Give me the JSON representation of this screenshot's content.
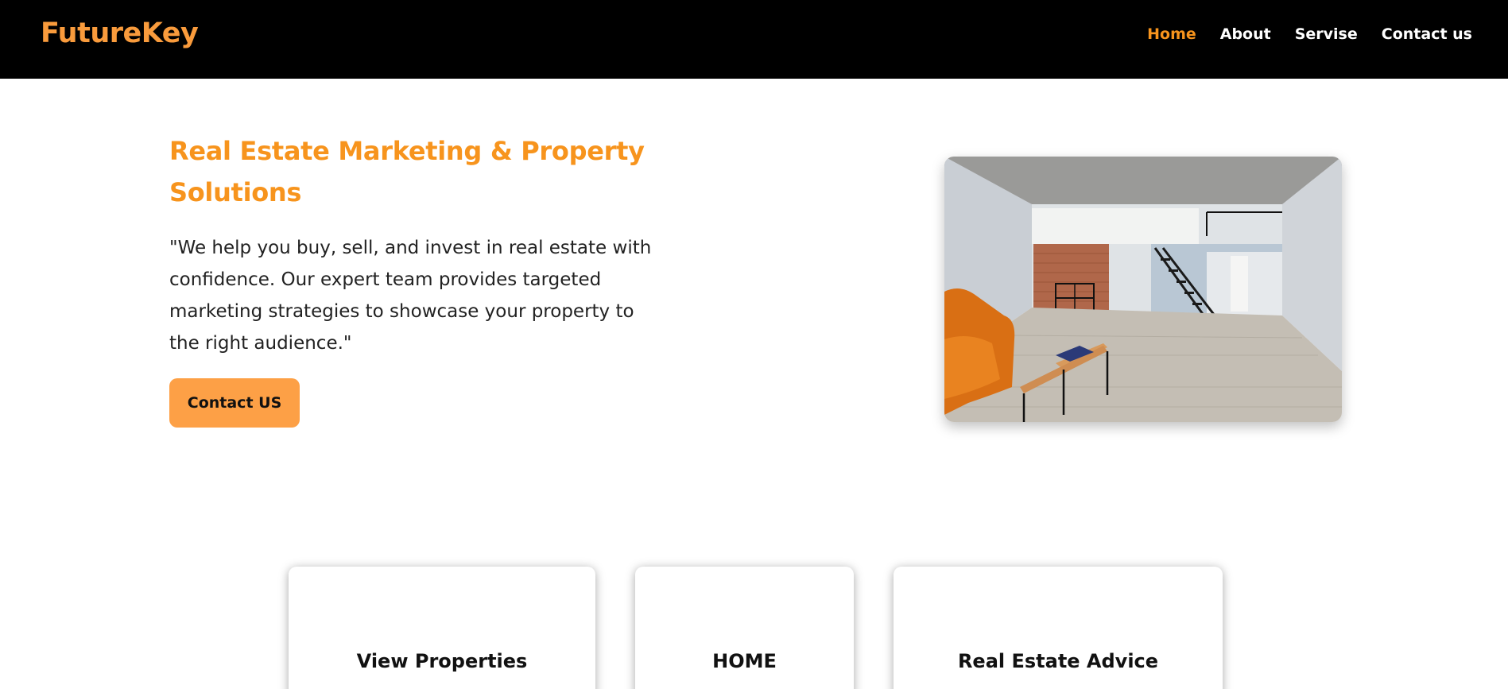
{
  "header": {
    "brand": "FutureKey",
    "nav": [
      {
        "label": "Home",
        "active": true
      },
      {
        "label": "About",
        "active": false
      },
      {
        "label": "Servise",
        "active": false
      },
      {
        "label": "Contact us",
        "active": false
      }
    ]
  },
  "hero": {
    "title": "Real Estate Marketing & Property Solutions",
    "description": "\"We help you buy, sell, and invest in real estate with confidence. Our expert team provides targeted marketing strategies to showcase your property to the right audience.\"",
    "cta_label": "Contact US"
  },
  "cards": [
    {
      "title": "View Properties"
    },
    {
      "title": "HOME"
    },
    {
      "title": "Real Estate Advice"
    }
  ],
  "colors": {
    "accent": "#f7941d",
    "brand": "#f99b3c",
    "button": "#fda046",
    "nav_background": "#000000"
  }
}
